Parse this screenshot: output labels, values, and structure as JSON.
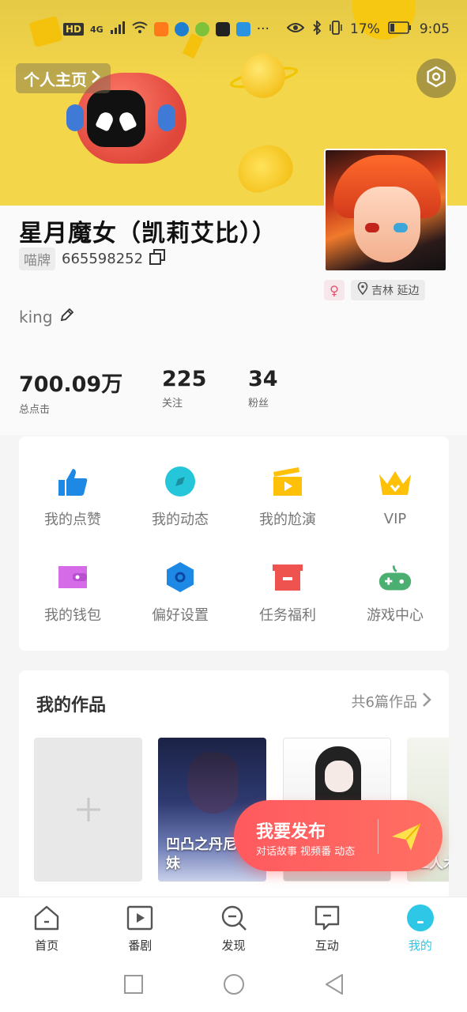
{
  "status_bar": {
    "network_label": "HD",
    "signal_label": "4G",
    "battery": "17%",
    "time": "9:05"
  },
  "header": {
    "home_label": "个人主页",
    "settings_icon": "settings-icon"
  },
  "profile": {
    "name": "星月魔女（凯莉艾比））",
    "id_tag": "喵牌",
    "id_number": "665598252",
    "gender_symbol": "♀",
    "location": "吉林 延边",
    "bio": "king"
  },
  "stats": [
    {
      "value": "700.09万",
      "label": "总点击"
    },
    {
      "value": "225",
      "label": "关注"
    },
    {
      "value": "34",
      "label": "粉丝"
    }
  ],
  "menu": [
    {
      "label": "我的点赞",
      "icon": "thumbs-up-icon",
      "color": "#1e88e5"
    },
    {
      "label": "我的动态",
      "icon": "compass-icon",
      "color": "#26c6da"
    },
    {
      "label": "我的尬演",
      "icon": "clapperboard-icon",
      "color": "#ffc107"
    },
    {
      "label": "VIP",
      "icon": "crown-icon",
      "color": "#ffc107"
    },
    {
      "label": "我的钱包",
      "icon": "wallet-icon",
      "color": "#d56be6"
    },
    {
      "label": "偏好设置",
      "icon": "hexagon-settings-icon",
      "color": "#1e88e5"
    },
    {
      "label": "任务福利",
      "icon": "box-icon",
      "color": "#ef5350"
    },
    {
      "label": "游戏中心",
      "icon": "gamepad-icon",
      "color": "#4caf72"
    }
  ],
  "works": {
    "title": "我的作品",
    "count_label": "共6篇作品",
    "items": [
      {
        "caption": "凹凸之丹尼的妹妹"
      },
      {
        "caption": ""
      },
      {
        "caption": "二人木"
      }
    ]
  },
  "publish": {
    "title": "我要发布",
    "subtitle": "对话故事 视频番 动态"
  },
  "bottom_nav": [
    {
      "label": "首页",
      "icon": "home-icon"
    },
    {
      "label": "番剧",
      "icon": "play-icon"
    },
    {
      "label": "发现",
      "icon": "search-icon"
    },
    {
      "label": "互动",
      "icon": "chat-icon"
    },
    {
      "label": "我的",
      "icon": "profile-icon",
      "active": true
    }
  ],
  "colors": {
    "banner": "#f4d64a",
    "accent": "#2fc7e6",
    "publish": "#ff5a5f"
  }
}
